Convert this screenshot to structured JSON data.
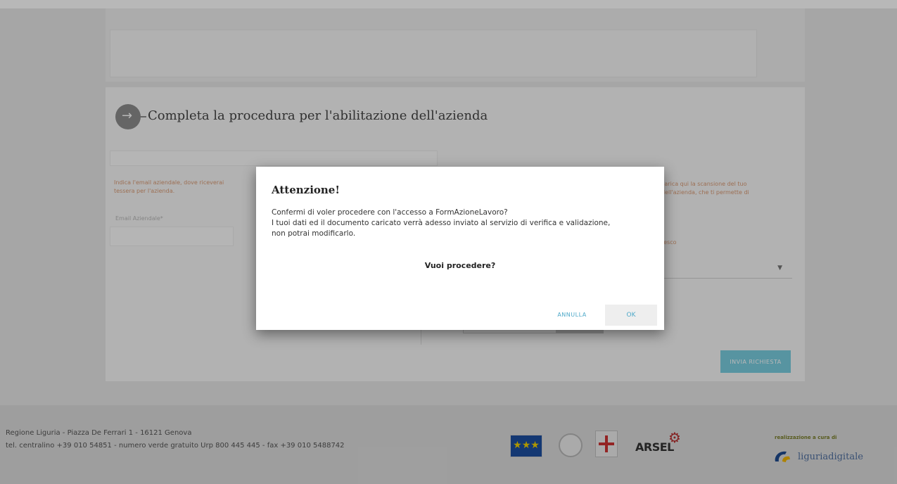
{
  "page": {
    "section_title": "Completa la procedura per l'abilitazione dell'azienda",
    "step_icon": "arrow-right-icon",
    "left_help": "Indica l'email aziendale, dove riceverai\ntessera per l'azienda.",
    "email_label": "Email Aziendale*",
    "right_help": "carica qui la scansione del tuo\ndell'azienda, che ti permette di",
    "right_help2": "tesco",
    "send_button": "INVIA RICHIESTA"
  },
  "dialog": {
    "title": "Attenzione!",
    "body_line1": "Confermi di voler procedere con l'accesso a FormAzioneLavoro?",
    "body_line2": "I tuoi dati ed il documento caricato verrà adesso inviato al servizio di verifica e validazione,",
    "body_line3": "non potrai modificarlo.",
    "question": "Vuoi procedere?",
    "cancel_label": "ANNULLA",
    "ok_label": "OK"
  },
  "footer": {
    "address": "Regione Liguria - Piazza De Ferrari 1 - 16121 Genova",
    "contacts": "tel. centralino +39 010 54851 - numero verde gratuito Urp 800 445 445 - fax +39 010 5488742",
    "arsel": "ARSEL",
    "credit": "realizzazione a cura di",
    "brand": "liguriadigitale"
  },
  "colors": {
    "accent": "#4ea9c9",
    "send_button": "#79cde0",
    "help_text": "#d99a74"
  }
}
